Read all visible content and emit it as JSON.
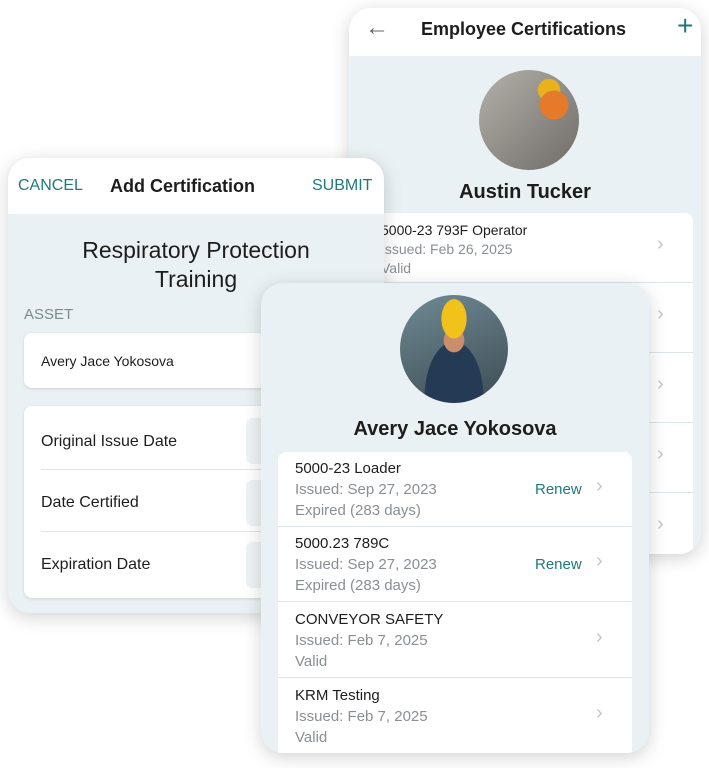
{
  "back_screen": {
    "title": "Employee Certifications",
    "back_icon": "arrow-left-icon",
    "add_icon": "plus-icon",
    "employee_name": "Austin Tucker",
    "certs": [
      {
        "name": "5000-23 793F Operator",
        "issued": "Issued: Feb 26, 2025",
        "status": "Valid"
      }
    ]
  },
  "form_screen": {
    "cancel": "CANCEL",
    "title": "Add Certification",
    "submit": "SUBMIT",
    "cert_title_line1": "Respiratory Protection",
    "cert_title_line2": "Training",
    "asset_label": "ASSET",
    "asset_value": "Avery Jace Yokosova",
    "dates": [
      {
        "label": "Original Issue Date"
      },
      {
        "label": "Date Certified"
      },
      {
        "label": "Expiration Date"
      }
    ]
  },
  "front_screen": {
    "employee_name": "Avery Jace Yokosova",
    "certs": [
      {
        "name": "5000-23 Loader",
        "issued": "Issued: Sep 27, 2023",
        "status": "Expired (283 days)",
        "action": "Renew"
      },
      {
        "name": "5000.23 789C",
        "issued": "Issued: Sep 27, 2023",
        "status": "Expired (283 days)",
        "action": "Renew"
      },
      {
        "name": "CONVEYOR SAFETY",
        "issued": "Issued: Feb 7, 2025",
        "status": "Valid"
      },
      {
        "name": "KRM Testing",
        "issued": "Issued: Feb 7, 2025",
        "status": "Valid"
      }
    ]
  },
  "colors": {
    "accent": "#1f7a7a",
    "expired": "#e0595e",
    "valid": "#3f8f7f",
    "background": "#e9f1f4"
  }
}
